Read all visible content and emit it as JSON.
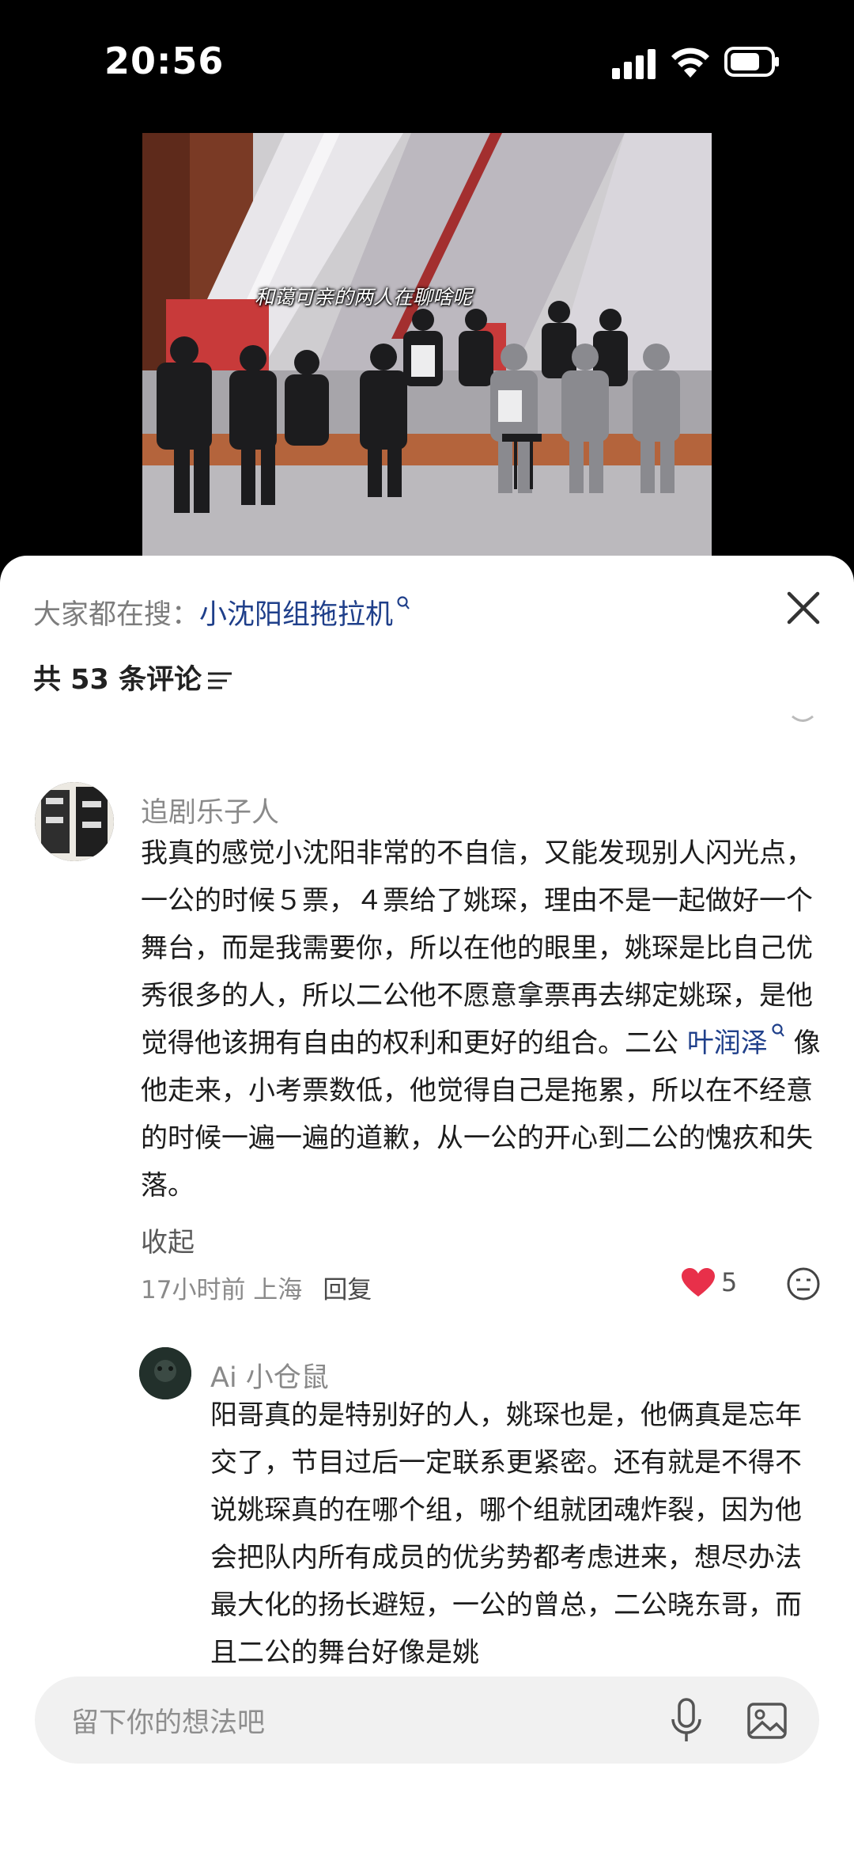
{
  "status_bar": {
    "time": "20:56"
  },
  "video": {
    "caption": "和蔼可亲的两人在聊啥呢"
  },
  "sheet": {
    "search_prefix": "大家都在搜：",
    "search_term": "小沈阳组拖拉机",
    "comment_count": "共 53 条评论"
  },
  "comment1": {
    "username": "追剧乐子人",
    "text_part1": "我真的感觉小沈阳非常的不自信，又能发现别人闪光点，一公的时候５票，４票给了姚琛，理由不是一起做好一个舞台，而是我需要你，所以在他的眼里，姚琛是比自己优秀很多的人，所以二公他不愿意拿票再去绑定姚琛，是他觉得他该拥有自由的权利和更好的组合。二公 ",
    "mention": "叶润泽",
    "text_part2": " 像他走来，小考票数低，他觉得自己是拖累，所以在不经意的时候一遍一遍的道歉，从一公的开心到二公的愧疚和失落。",
    "collapse": "收起",
    "time_location": "17小时前 上海",
    "reply": "回复",
    "likes": "5"
  },
  "reply1": {
    "username": "Ai 小仓鼠",
    "text": "阳哥真的是特别好的人，姚琛也是，他俩真是忘年交了，节目过后一定联系更紧密。还有就是不得不说姚琛真的在哪个组，哪个组就团魂炸裂，因为他会把队内所有成员的优劣势都考虑进来，想尽办法最大化的扬长避短，一公的曾总，二公晓东哥，而且二公的舞台好像是姚"
  },
  "input": {
    "placeholder": "留下你的想法吧"
  },
  "colors": {
    "accent_link": "#1f3f8a",
    "heart": "#e8304a"
  },
  "icons": [
    "signal-icon",
    "wifi-icon",
    "battery-icon",
    "close-icon",
    "search-icon",
    "filter-icon",
    "heart-icon",
    "emoji-icon",
    "mic-icon",
    "image-icon"
  ]
}
